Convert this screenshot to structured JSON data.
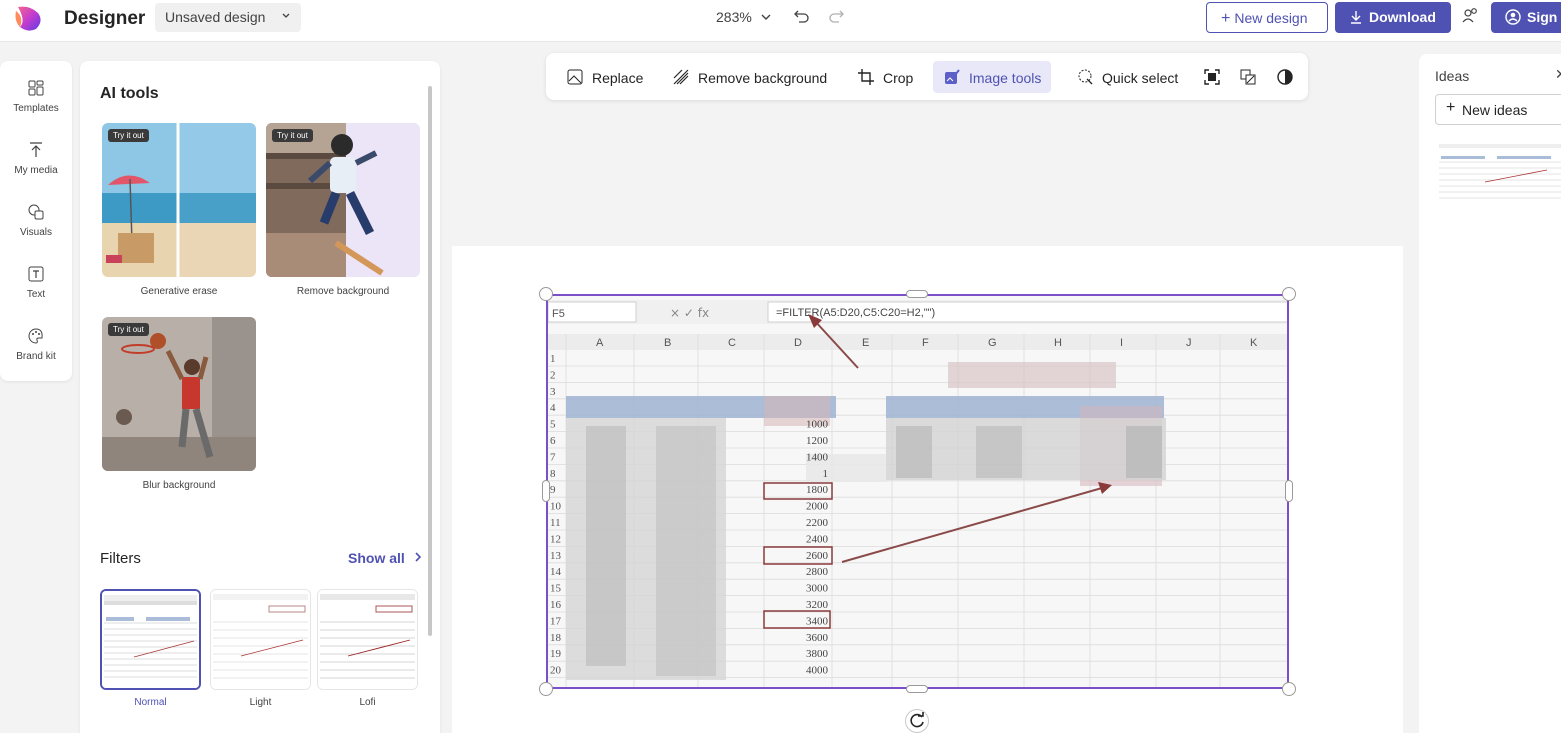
{
  "app": {
    "name": "Designer",
    "design_name": "Unsaved design"
  },
  "header": {
    "zoom": "283%",
    "new_design_label": "New design",
    "download_label": "Download",
    "sign_label": "Sign"
  },
  "rail": {
    "items": [
      {
        "label": "Templates",
        "icon": "templates-icon"
      },
      {
        "label": "My media",
        "icon": "upload-icon"
      },
      {
        "label": "Visuals",
        "icon": "visuals-icon"
      },
      {
        "label": "Text",
        "icon": "text-icon"
      },
      {
        "label": "Brand kit",
        "icon": "palette-icon"
      }
    ]
  },
  "ai_tools": {
    "title": "AI tools",
    "badge": "Try it out",
    "cards": [
      {
        "label": "Generative erase"
      },
      {
        "label": "Remove background"
      },
      {
        "label": "Blur background"
      }
    ]
  },
  "filters": {
    "title": "Filters",
    "show_all": "Show all",
    "items": [
      {
        "label": "Normal",
        "selected": true
      },
      {
        "label": "Light",
        "selected": false
      },
      {
        "label": "Lofi",
        "selected": false
      }
    ]
  },
  "toolbar": {
    "replace": "Replace",
    "remove_background": "Remove background",
    "crop": "Crop",
    "image_tools": "Image tools",
    "quick_select": "Quick select"
  },
  "spreadsheet": {
    "name_box": "F5",
    "formula": "=FILTER(A5:D20,C5:C20=H2,\"\")",
    "columns": [
      "A",
      "B",
      "C",
      "D",
      "E",
      "F",
      "G",
      "H",
      "I",
      "J",
      "K"
    ],
    "rows": [
      "1",
      "2",
      "3",
      "4",
      "5",
      "6",
      "7",
      "8",
      "9",
      "10",
      "11",
      "12",
      "13",
      "14",
      "15",
      "16",
      "17",
      "18",
      "19",
      "20"
    ],
    "d_values": [
      "1000",
      "1200",
      "1400",
      "1",
      "1800",
      "2000",
      "2200",
      "2400",
      "2600",
      "2800",
      "3000",
      "3200",
      "3400",
      "3600",
      "3800",
      "4000"
    ]
  },
  "ideas": {
    "title": "Ideas",
    "new_ideas": "New ideas"
  },
  "colors": {
    "accent": "#4f52b2",
    "selection": "#7b4fc8"
  }
}
